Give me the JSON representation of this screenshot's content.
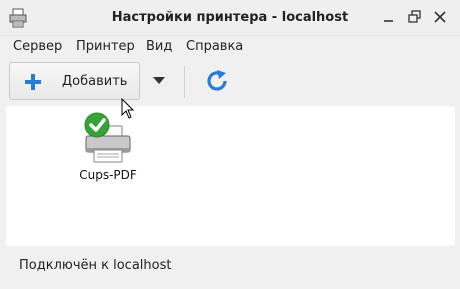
{
  "window": {
    "title": "Настройки принтера - localhost",
    "icon": "printer-app-icon"
  },
  "menu": [
    {
      "label": "Сервер"
    },
    {
      "label": "Принтер"
    },
    {
      "label": "Вид"
    },
    {
      "label": "Справка"
    }
  ],
  "toolbar": {
    "add_label": "Добавить",
    "add_icon": "plus-icon",
    "dropdown_icon": "chevron-down-icon",
    "refresh_icon": "refresh-icon"
  },
  "printers": [
    {
      "name": "Cups-PDF",
      "status_icon": "check-icon"
    }
  ],
  "status": {
    "text": "Подключён к localhost"
  },
  "colors": {
    "accent_blue": "#2a7ad8",
    "check_green": "#38a138"
  }
}
